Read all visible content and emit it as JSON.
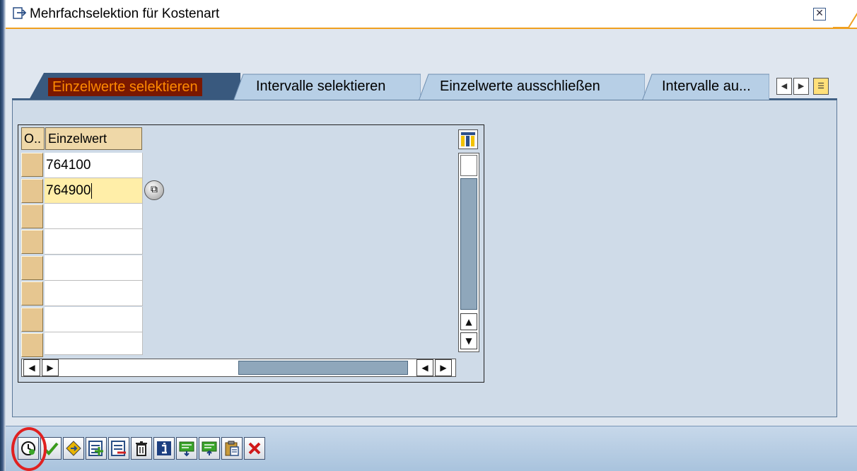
{
  "window": {
    "title": "Mehrfachselektion für Kostenart",
    "close_icon": "close-icon"
  },
  "tabs": [
    {
      "label": "Einzelwerte selektieren",
      "active": true
    },
    {
      "label": "Intervalle selektieren",
      "active": false
    },
    {
      "label": "Einzelwerte ausschließen",
      "active": false
    },
    {
      "label": "Intervalle au...",
      "active": false
    }
  ],
  "tab_nav": {
    "icons": [
      "scroll-left-icon",
      "scroll-right-icon",
      "tab-list-icon"
    ]
  },
  "table": {
    "columns": [
      "O..",
      "Einzelwert"
    ],
    "rows": [
      {
        "value": "764100"
      },
      {
        "value": "764900"
      },
      {
        "value": ""
      },
      {
        "value": ""
      },
      {
        "value": ""
      },
      {
        "value": ""
      },
      {
        "value": ""
      },
      {
        "value": ""
      }
    ],
    "active_row": 1
  },
  "toolbar": {
    "buttons": [
      "execute-icon",
      "confirm-check-icon",
      "copy-icon",
      "insert-row-icon",
      "delete-row-icon",
      "delete-all-icon",
      "info-icon",
      "import-icon",
      "paste-clipboard-icon",
      "cancel-icon"
    ]
  },
  "colors": {
    "accent_orange": "#f0a020",
    "active_tab_text": "#ff8a00",
    "active_tab_bg": "#7a1800",
    "panel_bg": "#cfdbe8",
    "header_cell": "#efd8a8",
    "highlight": "#e02020"
  }
}
